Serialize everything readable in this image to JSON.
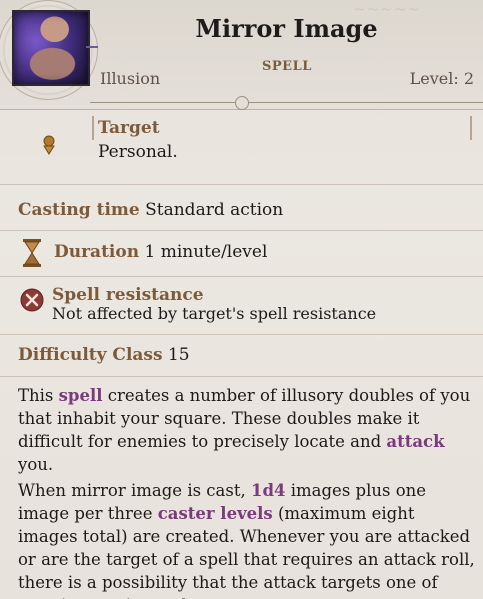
{
  "header": {
    "title": "Mirror Image",
    "school": "Illusion",
    "type": "SPELL",
    "level": "Level: 2"
  },
  "target": {
    "label": "Target",
    "value": "Personal."
  },
  "casting": {
    "label": "Casting time",
    "value": "Standard action"
  },
  "duration": {
    "label": "Duration",
    "value": "1 minute/level"
  },
  "spell_resistance": {
    "label": "Spell resistance",
    "value": "Not affected by target's spell resistance"
  },
  "difficulty": {
    "label": "Difficulty Class",
    "value": "15"
  },
  "description": {
    "p1": {
      "a": "This ",
      "k1": "spell",
      "b": " creates a number of illusory doubles of you that inhabit your square. These doubles make it difficult for enemies to precisely locate and ",
      "k2": "attack",
      "c": " you."
    },
    "p2": {
      "a": "When mirror image is cast, ",
      "k1": "1d4",
      "b": " images plus one image per three ",
      "k2": "caster levels",
      "c": " (maximum eight images total) are created. Whenever you are attacked or are the target of a spell that requires an attack roll, there is a possibility that the attack targets one of your images instead."
    }
  },
  "colors": {
    "label": "#7c5a3a",
    "keyword": "#7a3a7d",
    "background": "#e9e4dd"
  },
  "icons": {
    "portrait": "mirror-image-portrait",
    "target": "target-arrow-icon",
    "duration": "hourglass-icon",
    "spell_resistance": "no-resistance-icon"
  }
}
